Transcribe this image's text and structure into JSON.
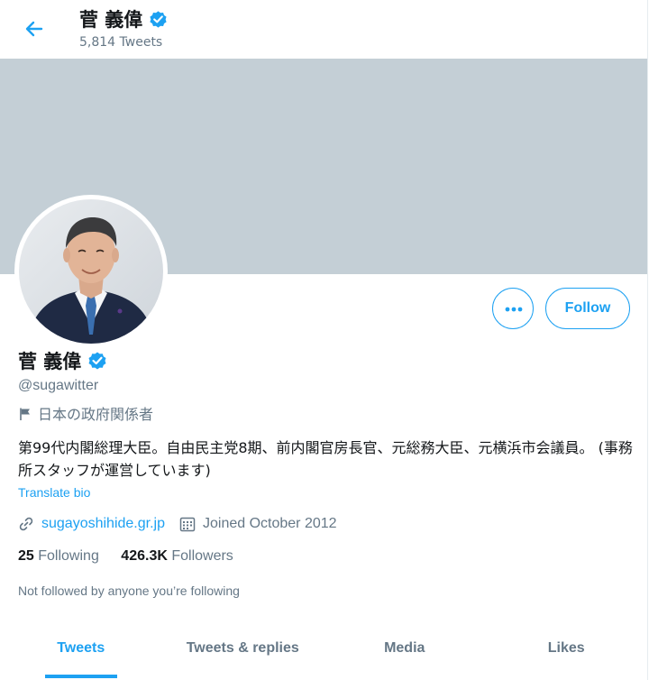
{
  "header": {
    "title": "菅 義偉",
    "tweet_count": "5,814 Tweets",
    "back_icon": "arrow-left-icon"
  },
  "profile": {
    "name": "菅 義偉",
    "handle": "@sugawitter",
    "affiliation": "日本の政府関係者",
    "bio": "第99代内閣総理大臣。自由民主党8期、前内閣官房長官、元総務大臣、元横浜市会議員。 (事務所スタッフが運営しています)",
    "translate_label": "Translate bio",
    "website": "sugayoshihide.gr.jp",
    "joined": "Joined October 2012",
    "following_count": "25",
    "following_label": "Following",
    "followers_count": "426.3K",
    "followers_label": "Followers",
    "not_followed_text": "Not followed by anyone you’re following"
  },
  "actions": {
    "follow_label": "Follow",
    "more_icon": "more-icon"
  },
  "tabs": [
    {
      "label": "Tweets",
      "active": true
    },
    {
      "label": "Tweets & replies",
      "active": false
    },
    {
      "label": "Media",
      "active": false
    },
    {
      "label": "Likes",
      "active": false
    }
  ],
  "colors": {
    "accent": "#1da1f2",
    "banner": "#c4cfd6",
    "muted": "#657786",
    "text": "#14171a"
  }
}
